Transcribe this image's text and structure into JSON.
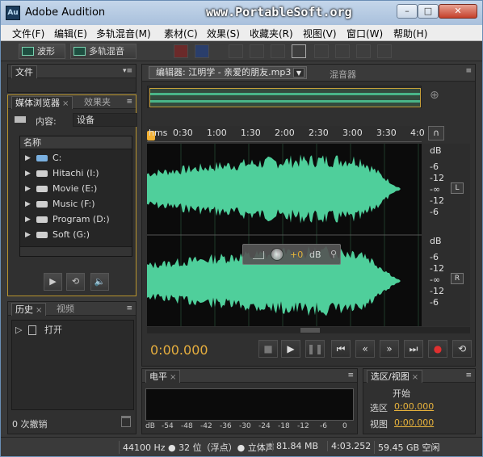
{
  "window": {
    "title": "Adobe Audition",
    "app_icon": "Au",
    "watermark": "www.PortableSoft.org",
    "minimize": "–",
    "maximize": "□",
    "close": "✕"
  },
  "menu": [
    "文件(F)",
    "编辑(E)",
    "多轨混音(M)",
    "素材(C)",
    "效果(S)",
    "收藏夹(R)",
    "视图(V)",
    "窗口(W)",
    "帮助(H)"
  ],
  "toolbar": {
    "waveform": "波形",
    "multitrack": "多轨混音"
  },
  "file_panel": {
    "tab": "文件"
  },
  "media_panel": {
    "tabs": [
      "媒体浏览器",
      "效果夹"
    ],
    "content_label": "内容:",
    "content_value": "设备",
    "list_header": "名称",
    "drives": [
      "C:",
      "Hitachi (I:)",
      "Movie (E:)",
      "Music (F:)",
      "Program (D:)",
      "Soft (G:)"
    ]
  },
  "history_panel": {
    "tabs": [
      "历史",
      "视频"
    ],
    "item": "打开",
    "undo_count": "0 次撤销"
  },
  "editor": {
    "tab": "编辑器: 江明学 - 亲爱的朋友.mp3",
    "mixer_tab": "混音器",
    "ruler": [
      "hms",
      "0:30",
      "1:00",
      "1:30",
      "2:00",
      "2:30",
      "3:00",
      "3:30",
      "4:0"
    ],
    "db_top": [
      "dB",
      "-6",
      "-12",
      "-∞",
      "-12",
      "-6"
    ],
    "db_bottom": [
      "dB",
      "-6",
      "-12",
      "-∞",
      "-12",
      "-6"
    ],
    "channel_left": "L",
    "channel_right": "R",
    "gain_value": "+0",
    "gain_unit": "dB",
    "time": "0:00.000"
  },
  "level_panel": {
    "tab": "电平",
    "ticks": [
      "dB",
      "-54",
      "-48",
      "-42",
      "-36",
      "-30",
      "-24",
      "-18",
      "-12",
      "-6",
      "0"
    ]
  },
  "selection_panel": {
    "tab": "选区/视图",
    "start_header": "开始",
    "selection_label": "选区",
    "selection_value": "0:00.000",
    "view_label": "视图",
    "view_value": "0:00.000"
  },
  "status": {
    "sample_rate": "44100 Hz ● 32 位（浮点）● 立体声",
    "size": "81.84 MB",
    "duration": "4:03.252",
    "free": "59.45 GB 空闲"
  },
  "colors": {
    "wave": "#4fcf9b",
    "accent": "#e6ae3e",
    "title_bar": "#b4c9e2"
  }
}
